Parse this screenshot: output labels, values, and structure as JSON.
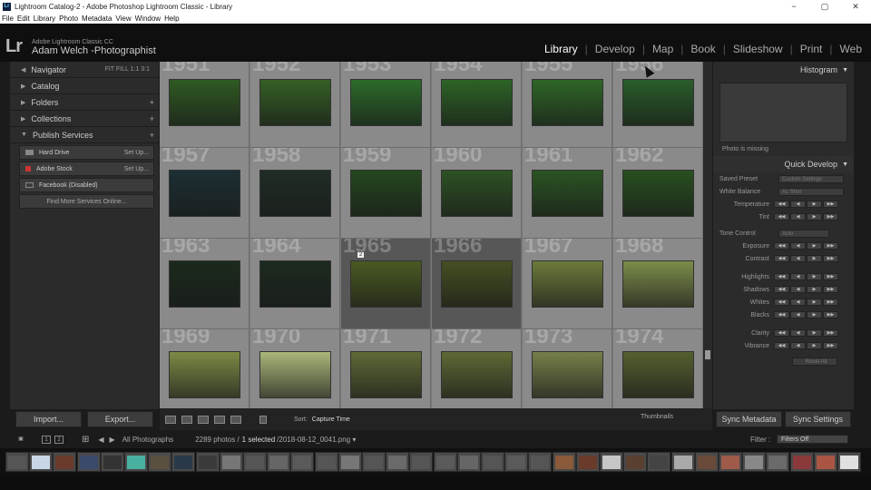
{
  "window": {
    "title": "Lightroom Catalog-2 - Adobe Photoshop Lightroom Classic - Library",
    "controls": [
      "−",
      "▢",
      "✕"
    ]
  },
  "menu": [
    "File",
    "Edit",
    "Library",
    "Photo",
    "Metadata",
    "View",
    "Window",
    "Help"
  ],
  "brand": {
    "logo": "Lr",
    "product": "Adobe Lightroom Classic CC",
    "user": "Adam Welch -Photographist"
  },
  "modules": [
    "Library",
    "Develop",
    "Map",
    "Book",
    "Slideshow",
    "Print",
    "Web"
  ],
  "active_module": "Library",
  "left_panel": {
    "navigator": {
      "label": "Navigator",
      "options": "FIT  FILL  1:1  3:1"
    },
    "catalog": "Catalog",
    "folders": "Folders",
    "collections": "Collections",
    "publish_services": "Publish Services",
    "services": [
      {
        "name": "Hard Drive",
        "action": "Set Up..."
      },
      {
        "name": "Adobe Stock",
        "action": "Set Up..."
      },
      {
        "name": "Facebook (Disabled)",
        "action": ""
      }
    ],
    "find_more": "Find More Services Online...",
    "import_label": "Import...",
    "export_label": "Export..."
  },
  "grid": {
    "cells": [
      {
        "num": "1951",
        "color": "#2f5a22",
        "selected": false
      },
      {
        "num": "1952",
        "color": "#355f25",
        "selected": false
      },
      {
        "num": "1953",
        "color": "#2c6b2a",
        "selected": false
      },
      {
        "num": "1954",
        "color": "#2d6326",
        "selected": false
      },
      {
        "num": "1955",
        "color": "#2e6627",
        "selected": false
      },
      {
        "num": "1956",
        "color": "#2a5d2a",
        "selected": false
      },
      {
        "num": "1957",
        "color": "#1c2f33",
        "selected": false
      },
      {
        "num": "1958",
        "color": "#202d25",
        "selected": false
      },
      {
        "num": "1959",
        "color": "#24471e",
        "selected": false
      },
      {
        "num": "1960",
        "color": "#2d5224",
        "selected": false
      },
      {
        "num": "1961",
        "color": "#2b5422",
        "selected": false
      },
      {
        "num": "1962",
        "color": "#28501f",
        "selected": false
      },
      {
        "num": "1963",
        "color": "#1b2a1c",
        "selected": false
      },
      {
        "num": "1964",
        "color": "#1c2a1e",
        "selected": false
      },
      {
        "num": "1965",
        "color": "#4a5a22",
        "selected": true
      },
      {
        "num": "1966",
        "color": "#454f22",
        "selected": true
      },
      {
        "num": "1967",
        "color": "#6b7a3a",
        "selected": false
      },
      {
        "num": "1968",
        "color": "#7c8c4a",
        "selected": false
      },
      {
        "num": "1969",
        "color": "#7b8a45",
        "selected": false
      },
      {
        "num": "1970",
        "color": "#a9b77a",
        "selected": false
      },
      {
        "num": "1971",
        "color": "#5e6a35",
        "selected": false
      },
      {
        "num": "1972",
        "color": "#5d6935",
        "selected": false
      },
      {
        "num": "1973",
        "color": "#76804a",
        "selected": false
      },
      {
        "num": "1974",
        "color": "#54602f",
        "selected": false
      }
    ],
    "badge": "2"
  },
  "toolbar": {
    "sort_label": "Sort:",
    "sort_value": "Capture Time",
    "thumbnails_label": "Thumbnails"
  },
  "right_panel": {
    "histogram": "Histogram",
    "photo_missing": "Photo is missing",
    "quick_develop": "Quick Develop",
    "saved_preset": "Saved Preset",
    "saved_preset_value": "Custom Settings",
    "white_balance": "White Balance",
    "white_balance_value": "As Shot",
    "temperature": "Temperature",
    "tint": "Tint",
    "tone_control": "Tone Control",
    "tone_value": "Auto",
    "exposure": "Exposure",
    "contrast": "Contrast",
    "highlights": "Highlights",
    "shadows": "Shadows",
    "whites": "Whites",
    "blacks": "Blacks",
    "clarity": "Clarity",
    "vibrance": "Vibrance",
    "reset_all": "Reset All",
    "sync_metadata": "Sync Metadata",
    "sync_settings": "Sync Settings"
  },
  "filmbar": {
    "pages": [
      "1",
      "2"
    ],
    "source": "All Photographs",
    "count": "2289 photos /",
    "selected": "1 selected",
    "filename": "/2018-08-12_0041.png ▾",
    "filter_label": "Filter :",
    "filter_value": "Filters Off"
  },
  "filmstrip_colors": [
    "#555",
    "#c9d6e6",
    "#6a3a2a",
    "#3a4a6a",
    "#333",
    "#4ab0a0",
    "#5a5040",
    "#2a3a4a",
    "#3a3a3a",
    "#777",
    "#555",
    "#666",
    "#5a5a5a",
    "#555",
    "#777",
    "#555",
    "#6a6a6a",
    "#555",
    "#5a5a5a",
    "#666",
    "#555",
    "#5a5a5a",
    "#555",
    "#8a5a3a",
    "#6a3a2a",
    "#c6c6c6",
    "#5a4030",
    "#444",
    "#aaa",
    "#6a4a3a",
    "#a05a4a",
    "#888",
    "#6a6a6a",
    "#8a3a3a",
    "#aa5544",
    "#e0e0e0"
  ]
}
